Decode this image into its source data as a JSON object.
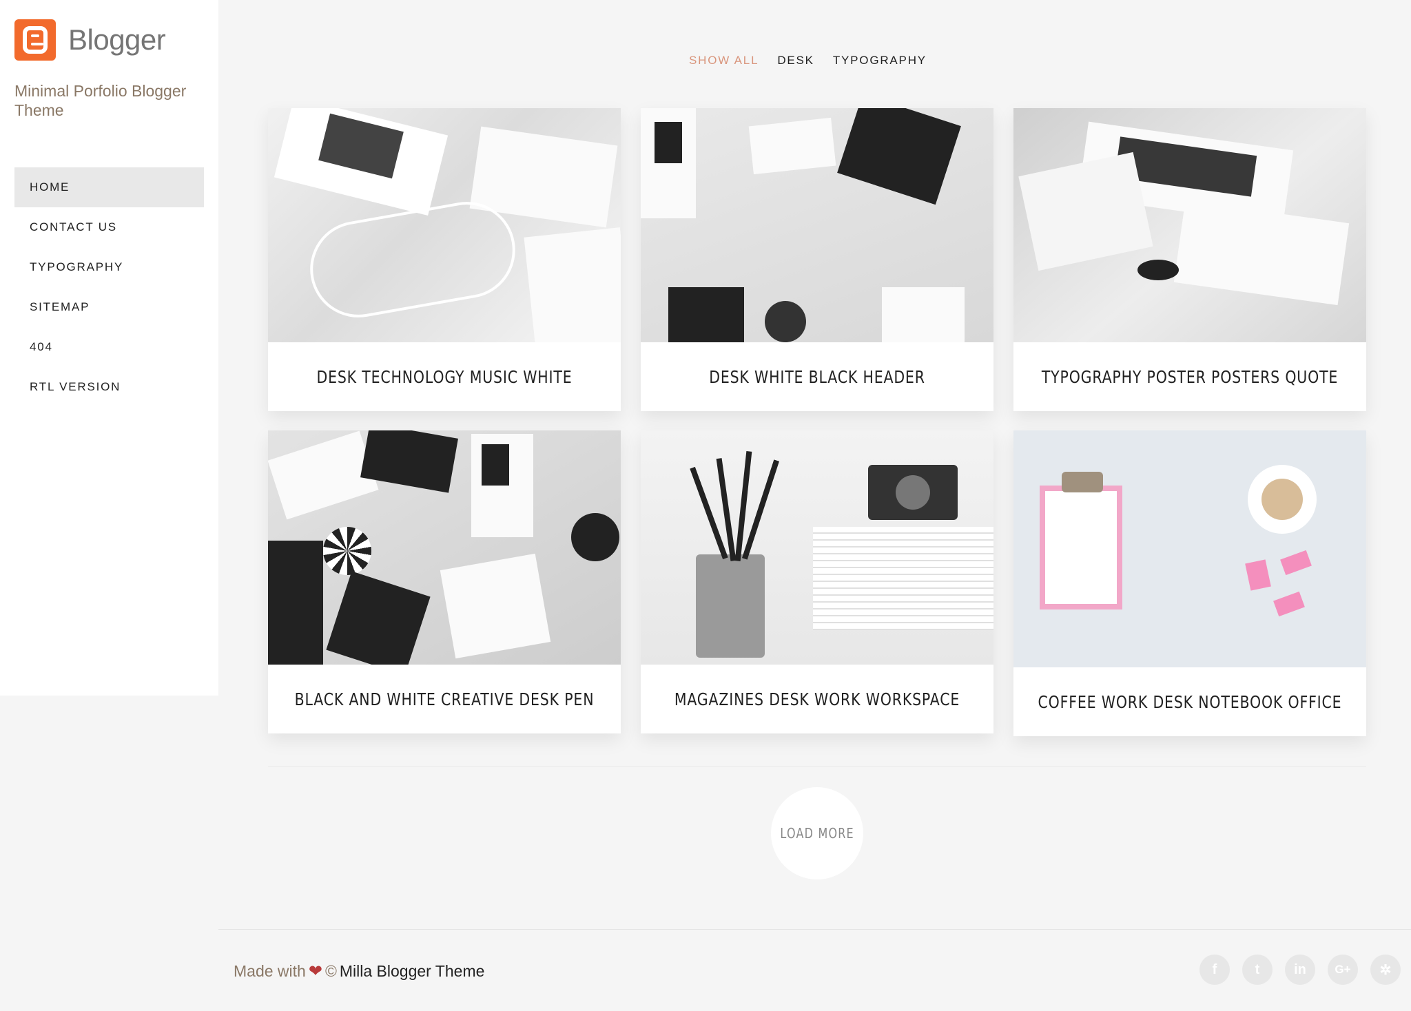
{
  "sidebar": {
    "logo_text": "Blogger",
    "tagline": "Minimal Porfolio Blogger Theme",
    "nav": [
      "HOME",
      "CONTACT US",
      "TYPOGRAPHY",
      "SITEMAP",
      "404",
      "RTL VERSION"
    ]
  },
  "filters": [
    "SHOW ALL",
    "DESK",
    "TYPOGRAPHY"
  ],
  "posts": [
    {
      "title": "DESK TECHNOLOGY MUSIC WHITE"
    },
    {
      "title": "DESK WHITE BLACK HEADER"
    },
    {
      "title": "TYPOGRAPHY POSTER POSTERS QUOTE"
    },
    {
      "title": "BLACK AND WHITE CREATIVE DESK PEN"
    },
    {
      "title": "MAGAZINES DESK WORK WORKSPACE"
    },
    {
      "title": "COFFEE WORK DESK NOTEBOOK OFFICE"
    }
  ],
  "load_more": "LOAD MORE",
  "footer": {
    "prefix": "Made with",
    "heart": "❤",
    "copyright": "©",
    "theme": "Milla Blogger Theme"
  },
  "socials": [
    "f",
    "t",
    "in",
    "G+",
    "✲"
  ],
  "colors": {
    "accent": "#d9957c",
    "logo": "#f26a2c",
    "muted": "#8a7866"
  }
}
